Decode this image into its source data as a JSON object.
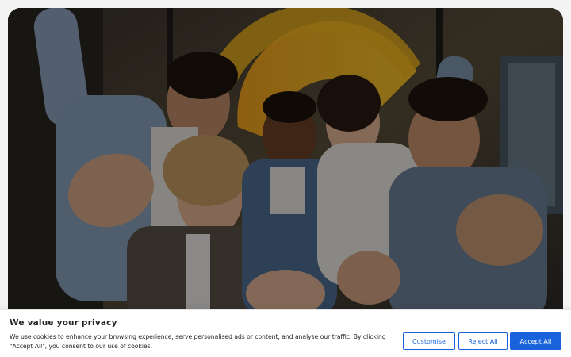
{
  "hero": {
    "image_label": "Group of five smiling colleagues reaching toward camera",
    "accent_color": "#f5b71f"
  },
  "cookie_banner": {
    "title": "We value your privacy",
    "text": "We use cookies to enhance your browsing experience, serve personalised ads or content, and analyse our traffic. By clicking \"Accept All\", you consent to our use of cookies.",
    "customise_label": "Customise",
    "reject_label": "Reject All",
    "accept_label": "Accept All",
    "brand_color": "#1863dc"
  }
}
